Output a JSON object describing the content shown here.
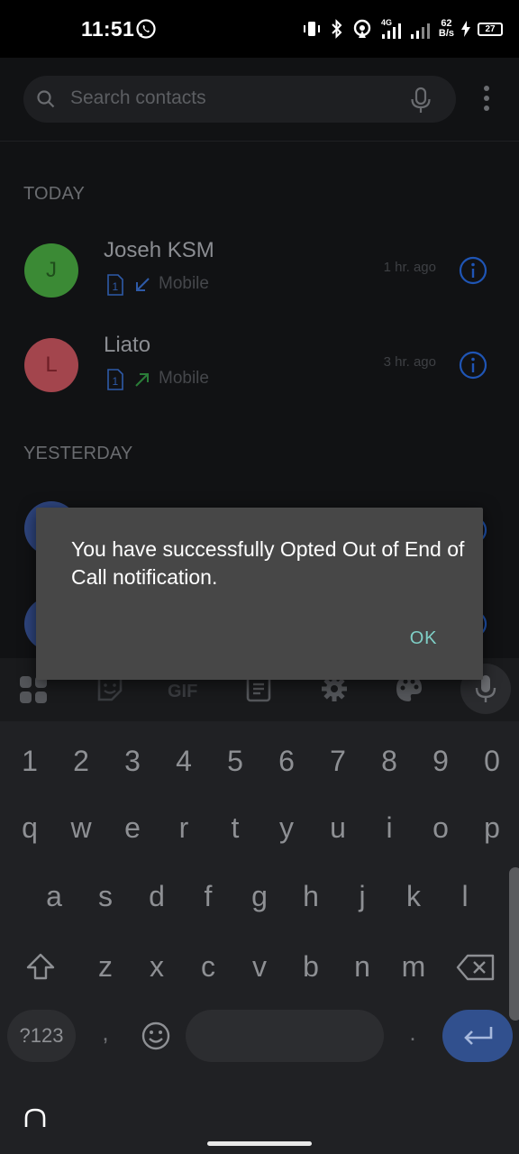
{
  "status_bar": {
    "time": "11:51",
    "network_label": "4G",
    "speed_value": "62",
    "speed_unit": "B/s",
    "battery": "27"
  },
  "search": {
    "placeholder": "Search contacts"
  },
  "sections": {
    "today": "TODAY",
    "yesterday": "YESTERDAY"
  },
  "calls": [
    {
      "initial": "J",
      "name": "Joseh KSM",
      "sim": "1",
      "type": "Mobile",
      "direction": "incoming",
      "time": "1 hr. ago",
      "avatar_color": "#3b8a35",
      "initial_color": "#1f4d1b"
    },
    {
      "initial": "L",
      "name": "Liato",
      "sim": "1",
      "type": "Mobile",
      "direction": "outgoing",
      "time": "3 hr. ago",
      "avatar_color": "#a3454d",
      "initial_color": "#6e1e26"
    }
  ],
  "dialog": {
    "message": "You have successfully Opted Out of End of Call notification.",
    "ok_label": "OK"
  },
  "keyboard": {
    "toolbar": [
      "apps-icon",
      "sticker-icon",
      "gif-icon",
      "clipboard-icon",
      "settings-icon",
      "palette-icon",
      "mic-icon"
    ],
    "gif_label": "GIF",
    "row_numbers": [
      "1",
      "2",
      "3",
      "4",
      "5",
      "6",
      "7",
      "8",
      "9",
      "0"
    ],
    "row_1": [
      "q",
      "w",
      "e",
      "r",
      "t",
      "y",
      "u",
      "i",
      "o",
      "p"
    ],
    "row_2": [
      "a",
      "s",
      "d",
      "f",
      "g",
      "h",
      "j",
      "k",
      "l"
    ],
    "row_3": [
      "z",
      "x",
      "c",
      "v",
      "b",
      "n",
      "m"
    ],
    "symbols_label": "?123",
    "comma": ",",
    "period": "."
  },
  "colors": {
    "accent": "#1a73e8",
    "dialog_bg": "#474747",
    "ok_text": "#7fcfc6",
    "enter_key": "#31508e"
  }
}
